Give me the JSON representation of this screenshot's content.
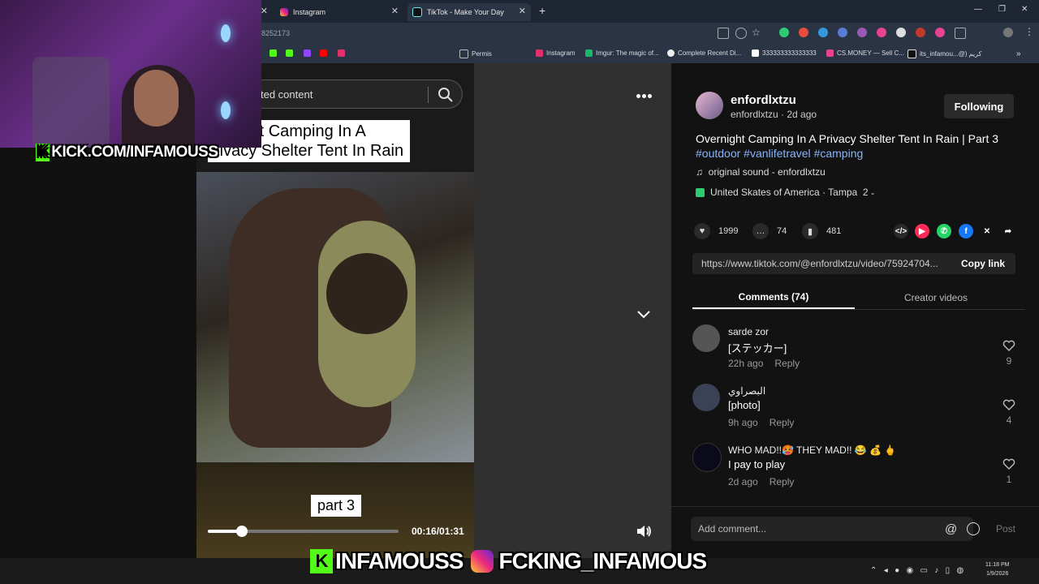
{
  "browser": {
    "tabs": [
      {
        "label": "Instagram"
      },
      {
        "label": "TikTok - Make Your Day"
      }
    ],
    "url_fragment": "8252173",
    "bookmarks": [
      "Permis",
      "Instagram",
      "Imgur: The magic of...",
      "Complete Recent Di...",
      "333333333333333",
      "CS.MONEY — Sell C...",
      "its_infamou...@) كريم"
    ]
  },
  "stream_overlay": {
    "kick_banner": "KICK.COM/INFAMOUSS",
    "kick_handle": "INFAMOUSS",
    "instagram_handle": "FCKING_INFAMOUS"
  },
  "video": {
    "search_text": "ted content",
    "title_line1": "ernight Camping In A",
    "title_line2": "rivacy Shelter Tent In Rain",
    "part_label": "part 3",
    "time": "00:16/01:31",
    "progress": 0.18
  },
  "post": {
    "username": "enfordlxtzu",
    "meta": "enfordlxtzu · 2d ago",
    "follow_label": "Following",
    "caption": "Overnight Camping In A Privacy Shelter Tent In Rain | Part 3",
    "hashtags": [
      "#outdoor",
      "#vanlifetravel",
      "#camping"
    ],
    "sound": "original sound - enfordlxtzu",
    "location": "United Skates of America · Tampa",
    "location_count": "2",
    "likes": "1999",
    "comments": "74",
    "saves": "481",
    "link": "https://www.tiktok.com/@enfordlxtzu/video/75924704...",
    "copy_label": "Copy link"
  },
  "tabs": {
    "comments": "Comments (74)",
    "creator": "Creator videos"
  },
  "comments": [
    {
      "user": "sarde zor",
      "text": "[ステッカー]",
      "time": "22h ago",
      "reply": "Reply",
      "likes": "9"
    },
    {
      "user": "البصراوي",
      "text": "[photo]",
      "time": "9h ago",
      "reply": "Reply",
      "likes": "4"
    },
    {
      "user": "WHO MAD!!🥵 THEY MAD!! 😂 💰 🖕",
      "text": "I pay to play",
      "time": "2d ago",
      "reply": "Reply",
      "likes": "1"
    }
  ],
  "comment_box": {
    "placeholder": "Add comment...",
    "post_label": "Post"
  },
  "taskbar": {
    "time": "11:18 PM",
    "date": "1/9/2026"
  },
  "colors": {
    "accent_kick": "#53fc18",
    "hashtag": "#8ab4f8",
    "panel_bg": "#121212"
  }
}
